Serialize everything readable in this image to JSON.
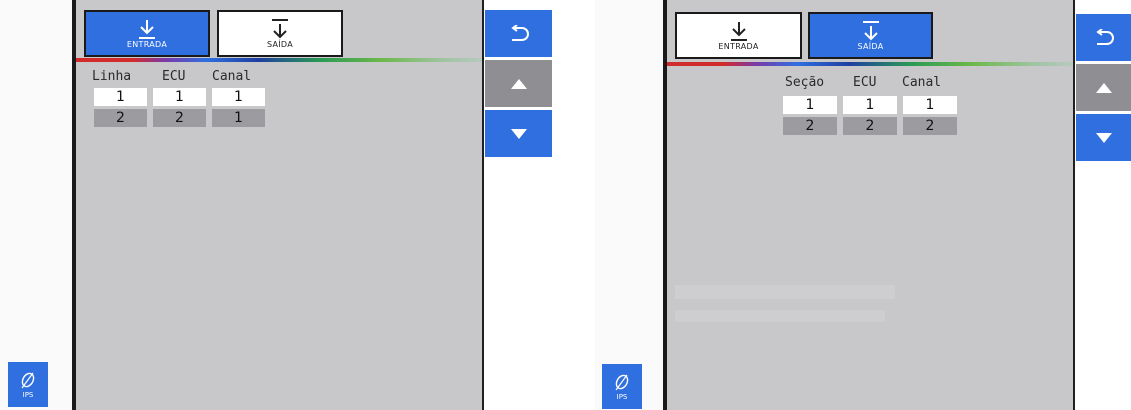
{
  "left": {
    "tabs": {
      "entrada": "ENTRADA",
      "saida": "SAÍDA",
      "active": "entrada"
    },
    "table": {
      "headers": [
        "Linha",
        "ECU",
        "Canal"
      ],
      "rows": [
        [
          "1",
          "1",
          "1"
        ],
        [
          "2",
          "2",
          "1"
        ]
      ]
    },
    "ips_label": "IPS"
  },
  "right": {
    "tabs": {
      "entrada": "ENTRADA",
      "saida": "SAÍDA",
      "active": "saida"
    },
    "table": {
      "headers": [
        "Seção",
        "ECU",
        "Canal"
      ],
      "rows": [
        [
          "1",
          "1",
          "1"
        ],
        [
          "2",
          "2",
          "2"
        ]
      ]
    },
    "ips_label": "IPS"
  },
  "colors": {
    "accent": "#2f6fe0",
    "panel_bg": "#c8c8cb",
    "scroll_up_disabled": "#8f8f93",
    "row_alt": "#9c9ca0"
  },
  "icons": [
    "download-arrow-icon",
    "back-icon",
    "chevron-up-icon",
    "chevron-down-icon",
    "leaf-icon"
  ]
}
